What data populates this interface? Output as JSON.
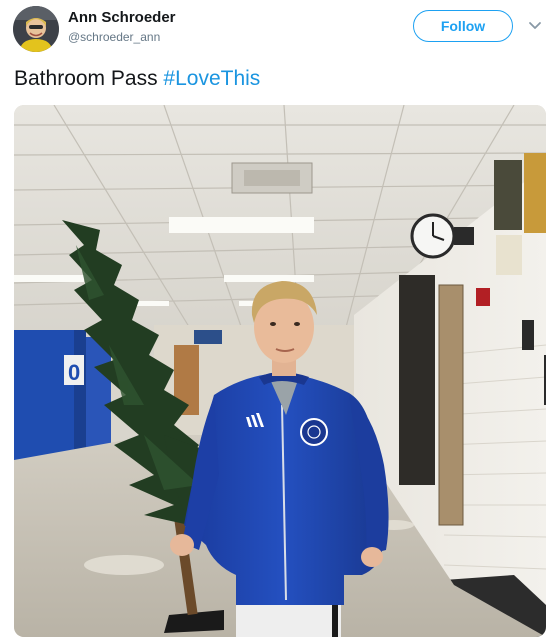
{
  "author": {
    "name": "Ann Schroeder",
    "handle": "@schroeder_ann",
    "avatar_icon": "profile-photo"
  },
  "follow_button": {
    "label": "Follow"
  },
  "menu": {
    "icon": "chevron-down-icon"
  },
  "tweet": {
    "text": "Bathroom Pass",
    "hashtag": "#LoveThis"
  },
  "photo": {
    "description_icon": "tweet-photo",
    "jacket_brand": "adidas",
    "locker_number": "0"
  },
  "colors": {
    "accent": "#1da1f2",
    "hashtag": "#1b95e0",
    "name": "#14171a",
    "handle": "#657786"
  }
}
